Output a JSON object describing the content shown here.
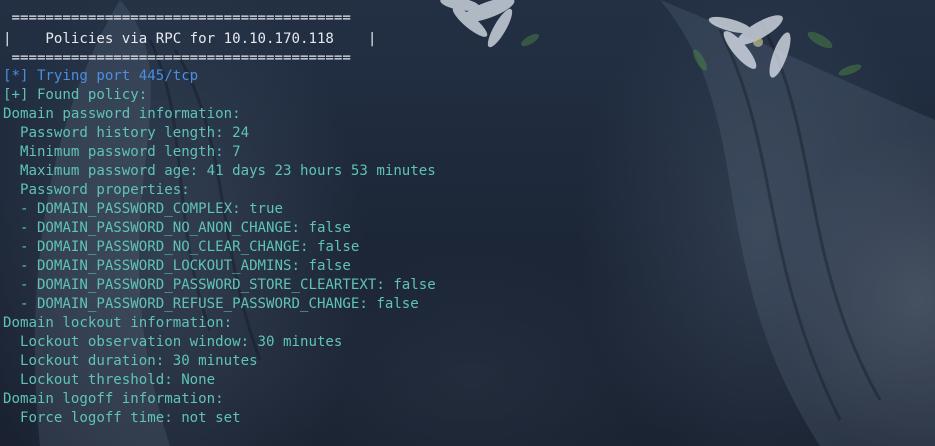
{
  "terminal": {
    "banner_top": " ========================================",
    "banner_title": "|    Policies via RPC for 10.10.170.118    |",
    "banner_bottom": " ========================================",
    "lines": [
      "[*] Trying port 445/tcp",
      "[+] Found policy:",
      "Domain password information:",
      "  Password history length: 24",
      "  Minimum password length: 7",
      "  Maximum password age: 41 days 23 hours 53 minutes",
      "  Password properties:",
      "  - DOMAIN_PASSWORD_COMPLEX: true",
      "  - DOMAIN_PASSWORD_NO_ANON_CHANGE: false",
      "  - DOMAIN_PASSWORD_NO_CLEAR_CHANGE: false",
      "  - DOMAIN_PASSWORD_LOCKOUT_ADMINS: false",
      "  - DOMAIN_PASSWORD_PASSWORD_STORE_CLEARTEXT: false",
      "  - DOMAIN_PASSWORD_REFUSE_PASSWORD_CHANGE: false",
      "Domain lockout information:",
      "  Lockout observation window: 30 minutes",
      "  Lockout duration: 30 minutes",
      "  Lockout threshold: None",
      "Domain logoff information:",
      "  Force logoff time: not set"
    ]
  },
  "colors": {
    "background": "#1b2433",
    "banner_text": "#e6e9ef",
    "info_text": "#4a8fe0",
    "output_text": "#5fc4b5"
  }
}
